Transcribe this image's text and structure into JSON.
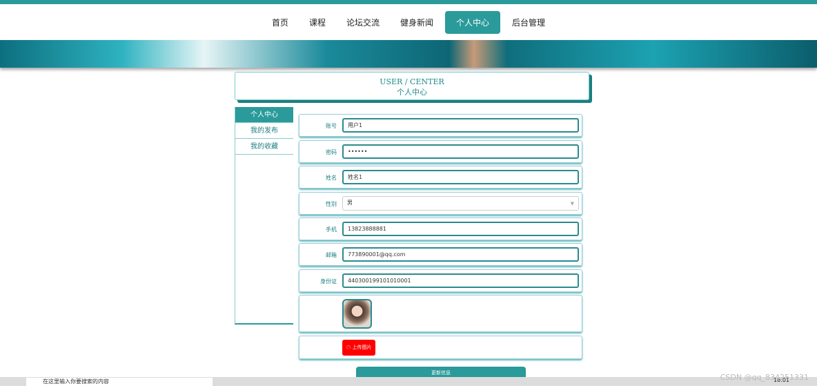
{
  "nav": {
    "items": [
      "首页",
      "课程",
      "论坛交流",
      "健身新闻",
      "个人中心",
      "后台管理"
    ],
    "active": 4
  },
  "title": {
    "en": "USER / CENTER",
    "cn": "个人中心"
  },
  "sidebar": {
    "items": [
      "个人中心",
      "我的发布",
      "我的收藏"
    ]
  },
  "form": {
    "account": {
      "label": "账号",
      "value": "用户1"
    },
    "password": {
      "label": "密码",
      "value": "••••••"
    },
    "name": {
      "label": "姓名",
      "value": "姓名1"
    },
    "gender": {
      "label": "性别",
      "value": "男"
    },
    "phone": {
      "label": "手机",
      "value": "13823888881"
    },
    "email": {
      "label": "邮箱",
      "value": "773890001@qq.com"
    },
    "idcard": {
      "label": "身份证",
      "value": "440300199101010001"
    },
    "upload_label": "上传图片",
    "update_label": "更新信息"
  },
  "taskbar": {
    "search_placeholder": "在这里输入你要搜索的内容",
    "time": "16:01"
  },
  "watermark": "CSDN @qq_834251331",
  "colors": {
    "accent": "#2a9a9a",
    "upload": "#ff0000"
  }
}
